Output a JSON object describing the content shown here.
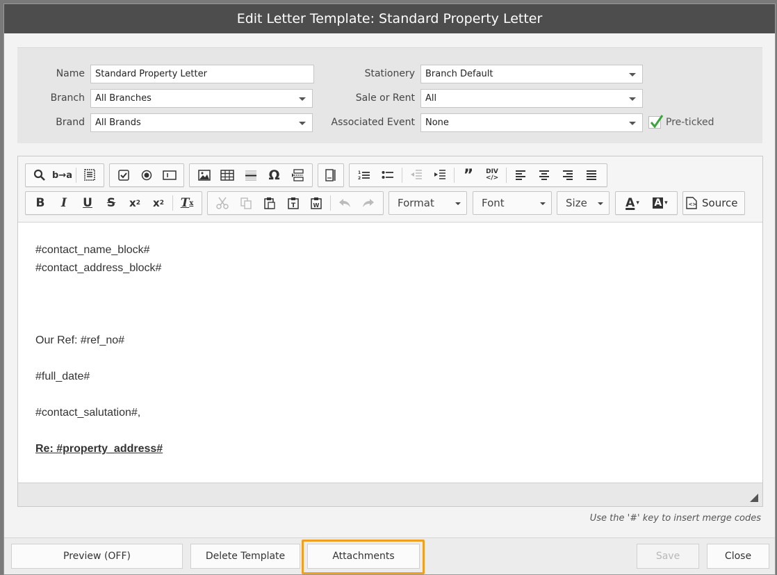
{
  "dialog": {
    "title": "Edit Letter Template: Standard Property Letter"
  },
  "form": {
    "name_label": "Name",
    "name_value": "Standard Property Letter",
    "branch_label": "Branch",
    "branch_value": "All Branches",
    "brand_label": "Brand",
    "brand_value": "All Brands",
    "stationery_label": "Stationery",
    "stationery_value": "Branch Default",
    "sale_rent_label": "Sale or Rent",
    "sale_rent_value": "All",
    "event_label": "Associated Event",
    "event_value": "None",
    "preticked_label": "Pre-ticked",
    "preticked_checked": true,
    "check_color": "#3aa63a"
  },
  "toolbar": {
    "format_label": "Format",
    "font_label": "Font",
    "size_label": "Size",
    "source_label": "Source",
    "icons_row1": [
      "find-icon",
      "replace-icon",
      "select-all-icon",
      "checkbox-icon",
      "radio-icon",
      "textfield-icon",
      "image-icon",
      "table-icon",
      "horizontal-rule-icon",
      "special-char-icon",
      "page-break-icon",
      "iframe-icon",
      "numbered-list-icon",
      "bulleted-list-icon",
      "outdent-icon",
      "indent-icon",
      "blockquote-icon",
      "div-icon",
      "align-left-icon",
      "align-center-icon",
      "align-right-icon",
      "justify-icon"
    ],
    "icons_row2": [
      "bold-icon",
      "italic-icon",
      "underline-icon",
      "strikethrough-icon",
      "subscript-icon",
      "superscript-icon",
      "remove-format-icon",
      "cut-icon",
      "copy-icon",
      "paste-icon",
      "paste-text-icon",
      "paste-word-icon",
      "undo-icon",
      "redo-icon",
      "text-color-icon",
      "bg-color-icon"
    ]
  },
  "editor": {
    "line1": "#contact_name_block#",
    "line2": "#contact_address_block#",
    "line3": "Our Ref: #ref_no#",
    "line4": "#full_date#",
    "line5": "#contact_salutation#,",
    "line6": "Re: #property_address#"
  },
  "hint": "Use the '#' key to insert merge codes",
  "footer": {
    "preview_label": "Preview (OFF)",
    "delete_label": "Delete Template",
    "attachments_label": "Attachments",
    "save_label": "Save",
    "close_label": "Close",
    "highlight_color": "#f0a020"
  }
}
